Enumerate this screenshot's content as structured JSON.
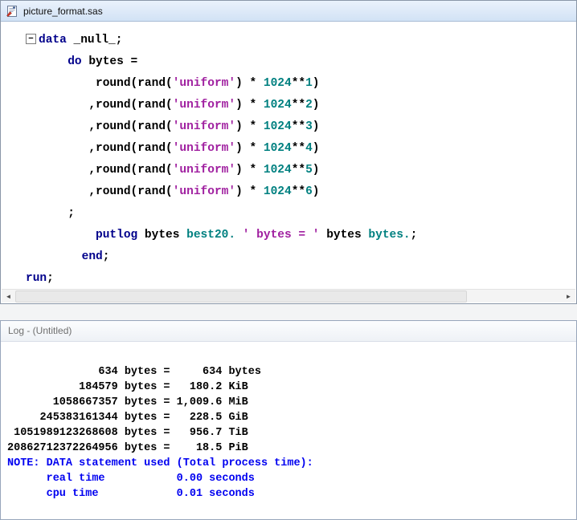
{
  "colors": {
    "keyword": "#00008b",
    "string": "#a020a0",
    "number": "#008080",
    "codetext": "#000000",
    "logtext": "#000000",
    "lognote": "#0000f0"
  },
  "editor": {
    "title": "picture_format.sas",
    "fold_glyph": "−",
    "scrollbar": {
      "left_arrow": "◄",
      "right_arrow": "►"
    },
    "code": [
      {
        "fold": true,
        "tokens": [
          {
            "t": "data",
            "c": "kw"
          },
          {
            "t": " _null_;",
            "c": "plain"
          }
        ]
      },
      {
        "tokens": [
          {
            "t": "      ",
            "c": "plain"
          },
          {
            "t": "do",
            "c": "kw"
          },
          {
            "t": " bytes =",
            "c": "plain"
          }
        ]
      },
      {
        "tokens": [
          {
            "t": "          round(rand(",
            "c": "plain"
          },
          {
            "t": "'uniform'",
            "c": "str"
          },
          {
            "t": ") * ",
            "c": "plain"
          },
          {
            "t": "1024",
            "c": "num"
          },
          {
            "t": "**",
            "c": "plain"
          },
          {
            "t": "1",
            "c": "num"
          },
          {
            "t": ")",
            "c": "plain"
          }
        ]
      },
      {
        "tokens": [
          {
            "t": "         ,round(rand(",
            "c": "plain"
          },
          {
            "t": "'uniform'",
            "c": "str"
          },
          {
            "t": ") * ",
            "c": "plain"
          },
          {
            "t": "1024",
            "c": "num"
          },
          {
            "t": "**",
            "c": "plain"
          },
          {
            "t": "2",
            "c": "num"
          },
          {
            "t": ")",
            "c": "plain"
          }
        ]
      },
      {
        "tokens": [
          {
            "t": "         ,round(rand(",
            "c": "plain"
          },
          {
            "t": "'uniform'",
            "c": "str"
          },
          {
            "t": ") * ",
            "c": "plain"
          },
          {
            "t": "1024",
            "c": "num"
          },
          {
            "t": "**",
            "c": "plain"
          },
          {
            "t": "3",
            "c": "num"
          },
          {
            "t": ")",
            "c": "plain"
          }
        ]
      },
      {
        "tokens": [
          {
            "t": "         ,round(rand(",
            "c": "plain"
          },
          {
            "t": "'uniform'",
            "c": "str"
          },
          {
            "t": ") * ",
            "c": "plain"
          },
          {
            "t": "1024",
            "c": "num"
          },
          {
            "t": "**",
            "c": "plain"
          },
          {
            "t": "4",
            "c": "num"
          },
          {
            "t": ")",
            "c": "plain"
          }
        ]
      },
      {
        "tokens": [
          {
            "t": "         ,round(rand(",
            "c": "plain"
          },
          {
            "t": "'uniform'",
            "c": "str"
          },
          {
            "t": ") * ",
            "c": "plain"
          },
          {
            "t": "1024",
            "c": "num"
          },
          {
            "t": "**",
            "c": "plain"
          },
          {
            "t": "5",
            "c": "num"
          },
          {
            "t": ")",
            "c": "plain"
          }
        ]
      },
      {
        "tokens": [
          {
            "t": "         ,round(rand(",
            "c": "plain"
          },
          {
            "t": "'uniform'",
            "c": "str"
          },
          {
            "t": ") * ",
            "c": "plain"
          },
          {
            "t": "1024",
            "c": "num"
          },
          {
            "t": "**",
            "c": "plain"
          },
          {
            "t": "6",
            "c": "num"
          },
          {
            "t": ")",
            "c": "plain"
          }
        ]
      },
      {
        "tokens": [
          {
            "t": "      ;",
            "c": "plain"
          }
        ]
      },
      {
        "tokens": [
          {
            "t": "          ",
            "c": "plain"
          },
          {
            "t": "putlog",
            "c": "kw"
          },
          {
            "t": " bytes ",
            "c": "plain"
          },
          {
            "t": "best20.",
            "c": "num"
          },
          {
            "t": " ",
            "c": "plain"
          },
          {
            "t": "' bytes = '",
            "c": "str"
          },
          {
            "t": " bytes ",
            "c": "plain"
          },
          {
            "t": "bytes.",
            "c": "num"
          },
          {
            "t": ";",
            "c": "plain"
          }
        ]
      },
      {
        "tokens": [
          {
            "t": "        ",
            "c": "plain"
          },
          {
            "t": "end",
            "c": "kw"
          },
          {
            "t": ";",
            "c": "plain"
          }
        ]
      },
      {
        "tokens": [
          {
            "t": "run",
            "c": "kw"
          },
          {
            "t": ";",
            "c": "plain"
          }
        ]
      }
    ]
  },
  "log": {
    "title": "Log - (Untitled)",
    "lines": [
      {
        "type": "output",
        "text": "              634 bytes =     634 bytes"
      },
      {
        "type": "output",
        "text": "           184579 bytes =   180.2 KiB"
      },
      {
        "type": "output",
        "text": "       1058667357 bytes = 1,009.6 MiB"
      },
      {
        "type": "output",
        "text": "     245383161344 bytes =   228.5 GiB"
      },
      {
        "type": "output",
        "text": " 1051989123268608 bytes =   956.7 TiB"
      },
      {
        "type": "output",
        "text": "20862712372264956 bytes =    18.5 PiB"
      },
      {
        "type": "note",
        "text": "NOTE: DATA statement used (Total process time):"
      },
      {
        "type": "note",
        "text": "      real time           0.00 seconds"
      },
      {
        "type": "note",
        "text": "      cpu time            0.01 seconds"
      }
    ]
  }
}
